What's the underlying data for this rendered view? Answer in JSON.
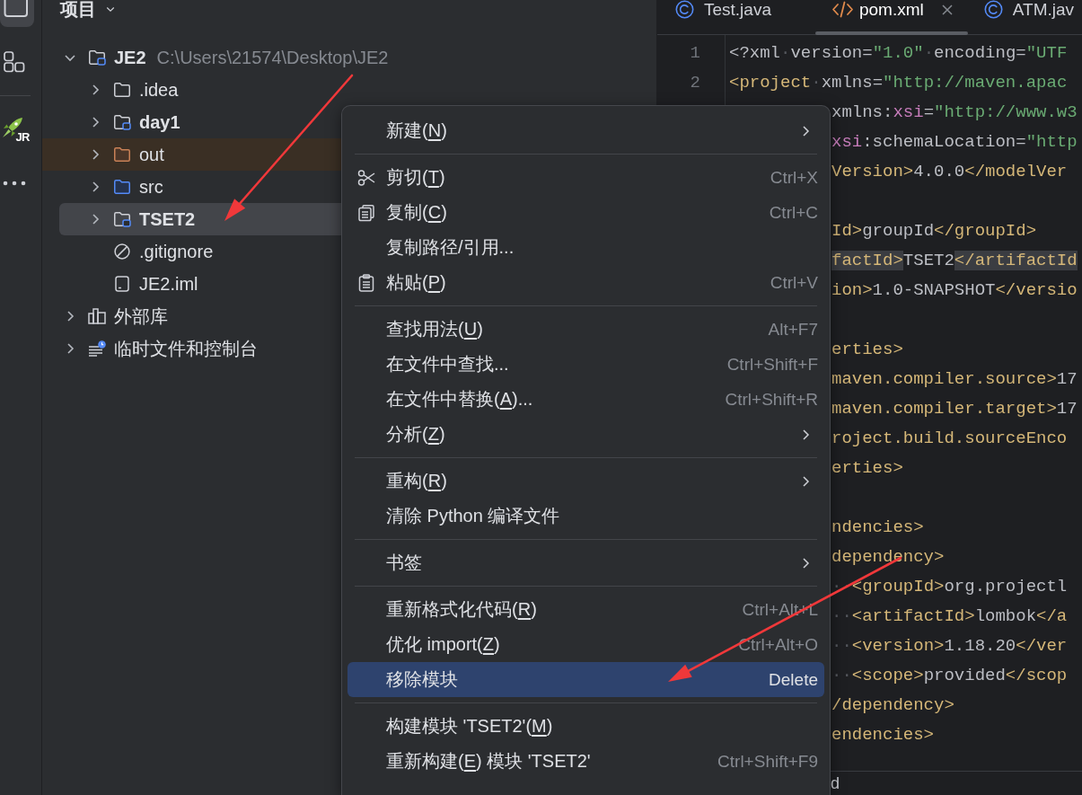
{
  "activity_bar": {
    "items": [
      {
        "kind": "project",
        "selected": true
      },
      {
        "kind": "structure",
        "selected": false
      },
      {
        "kind": "separator"
      },
      {
        "kind": "plugin",
        "label": "JR",
        "selected": false
      },
      {
        "kind": "more",
        "selected": false
      }
    ]
  },
  "project_panel": {
    "title": "项目",
    "tree": [
      {
        "kind": "module",
        "label": "JE2",
        "path": "C:\\Users\\21574\\Desktop\\JE2",
        "expanded": true,
        "selected": false,
        "children": [
          {
            "kind": "folder",
            "label": ".idea",
            "expanded": false,
            "selected": false
          },
          {
            "kind": "module",
            "label": "day1",
            "expanded": false,
            "selected": false
          },
          {
            "kind": "excluded_folder",
            "label": "out",
            "expanded": false,
            "selected": false
          },
          {
            "kind": "source_folder",
            "label": "src",
            "expanded": false,
            "selected": false
          },
          {
            "kind": "module",
            "label": "TSET2",
            "expanded": false,
            "selected": true
          },
          {
            "kind": "ignore_file",
            "label": ".gitignore",
            "selected": false
          },
          {
            "kind": "module_file",
            "label": "JE2.iml",
            "selected": false
          }
        ]
      },
      {
        "kind": "libraries",
        "label": "外部库",
        "expanded": false,
        "selected": false
      },
      {
        "kind": "scratches",
        "label": "临时文件和控制台",
        "expanded": false,
        "selected": false
      }
    ]
  },
  "editor": {
    "tabs": [
      {
        "kind": "class",
        "label": "Test.java",
        "selected": false
      },
      {
        "kind": "xml",
        "label": "pom.xml",
        "selected": true
      },
      {
        "kind": "class",
        "label": "ATM.jav",
        "selected": false
      }
    ],
    "lines": [
      {
        "number": "1",
        "tokens": [
          {
            "kind": "plain",
            "text": "<?xml"
          },
          {
            "kind": "space",
            "text": "·"
          },
          {
            "kind": "plain",
            "text": "version="
          },
          {
            "kind": "string",
            "text": "\"1.0\""
          },
          {
            "kind": "space",
            "text": "·"
          },
          {
            "kind": "plain",
            "text": "encoding="
          },
          {
            "kind": "string",
            "text": "\"UTF"
          }
        ]
      },
      {
        "number": "2",
        "tokens": [
          {
            "kind": "tag",
            "text": "<project"
          },
          {
            "kind": "space",
            "text": "·"
          },
          {
            "kind": "plain",
            "text": "xmlns="
          },
          {
            "kind": "string",
            "text": "\"http://maven.apac"
          }
        ]
      }
    ],
    "partial_lines": [
      {
        "kind": "code",
        "tokens": [
          {
            "kind": "plain",
            "text": "xmlns:"
          },
          {
            "kind": "ns",
            "text": "xsi"
          },
          {
            "kind": "plain",
            "text": "="
          },
          {
            "kind": "string",
            "text": "\"http://www.w3"
          }
        ]
      },
      {
        "kind": "code",
        "tokens": [
          {
            "kind": "ns",
            "text": "xsi"
          },
          {
            "kind": "plain",
            "text": ":schemaLocation="
          },
          {
            "kind": "string",
            "text": "\"http"
          }
        ]
      },
      {
        "kind": "code",
        "tokens": [
          {
            "kind": "tag",
            "text": "Version>"
          },
          {
            "kind": "plain",
            "text": "4.0.0"
          },
          {
            "kind": "tag",
            "text": "</modelVer"
          }
        ]
      },
      {
        "kind": "blank"
      },
      {
        "kind": "code",
        "tokens": [
          {
            "kind": "tag",
            "text": "Id>"
          },
          {
            "kind": "plain",
            "text": "groupId"
          },
          {
            "kind": "tag",
            "text": "</groupId>"
          }
        ]
      },
      {
        "kind": "code",
        "tokens": [
          {
            "kind": "tag_match",
            "text": "factId>"
          },
          {
            "kind": "plain",
            "text": "TSET2"
          },
          {
            "kind": "tag_match",
            "text": "</artifactId"
          }
        ]
      },
      {
        "kind": "code",
        "tokens": [
          {
            "kind": "tag",
            "text": "ion>"
          },
          {
            "kind": "plain",
            "text": "1.0-SNAPSHOT"
          },
          {
            "kind": "tag",
            "text": "</versio"
          }
        ]
      },
      {
        "kind": "blank"
      },
      {
        "kind": "code",
        "tokens": [
          {
            "kind": "tag",
            "text": "erties>"
          }
        ]
      },
      {
        "kind": "code",
        "tokens": [
          {
            "kind": "tag",
            "text": "maven.compiler.source>"
          },
          {
            "kind": "plain",
            "text": "17"
          }
        ]
      },
      {
        "kind": "code",
        "tokens": [
          {
            "kind": "tag",
            "text": "maven.compiler.target>"
          },
          {
            "kind": "plain",
            "text": "17"
          }
        ]
      },
      {
        "kind": "code",
        "tokens": [
          {
            "kind": "tag",
            "text": "roject.build.sourceEnco"
          }
        ]
      },
      {
        "kind": "code",
        "tokens": [
          {
            "kind": "tag",
            "text": "erties>"
          }
        ]
      },
      {
        "kind": "blank"
      },
      {
        "kind": "code",
        "tokens": [
          {
            "kind": "tag",
            "text": "ndencies>"
          }
        ]
      },
      {
        "kind": "code",
        "tokens": [
          {
            "kind": "tag",
            "text": "dependency>"
          }
        ]
      },
      {
        "kind": "code",
        "tokens": [
          {
            "kind": "space",
            "text": "··"
          },
          {
            "kind": "tag",
            "text": "<groupId>"
          },
          {
            "kind": "plain",
            "text": "org.projectl"
          }
        ]
      },
      {
        "kind": "code",
        "tokens": [
          {
            "kind": "space",
            "text": "··"
          },
          {
            "kind": "tag",
            "text": "<artifactId>"
          },
          {
            "kind": "plain",
            "text": "lombok"
          },
          {
            "kind": "tag",
            "text": "</a"
          }
        ]
      },
      {
        "kind": "code",
        "tokens": [
          {
            "kind": "space",
            "text": "··"
          },
          {
            "kind": "tag",
            "text": "<version>"
          },
          {
            "kind": "plain",
            "text": "1.18.20"
          },
          {
            "kind": "tag",
            "text": "</ver"
          }
        ]
      },
      {
        "kind": "code",
        "tokens": [
          {
            "kind": "space",
            "text": "··"
          },
          {
            "kind": "tag",
            "text": "<scope>"
          },
          {
            "kind": "plain",
            "text": "provided"
          },
          {
            "kind": "tag",
            "text": "</scop"
          }
        ]
      },
      {
        "kind": "code",
        "tokens": [
          {
            "kind": "tag",
            "text": "/dependency>"
          }
        ]
      },
      {
        "kind": "code",
        "tokens": [
          {
            "kind": "tag",
            "text": "endencies>"
          }
        ]
      }
    ],
    "breadcrumb": "d"
  },
  "context_menu": {
    "items": [
      {
        "kind": "action",
        "label": "新建(",
        "mnemonic": "N",
        "label_end": ")",
        "submenu": true,
        "selected": false
      },
      {
        "kind": "separator"
      },
      {
        "kind": "action",
        "label": "剪切(",
        "mnemonic": "T",
        "label_end": ")",
        "shortcut": "Ctrl+X",
        "submenu": false,
        "selected": false
      },
      {
        "kind": "action",
        "label": "复制(",
        "mnemonic": "C",
        "label_end": ")",
        "shortcut": "Ctrl+C",
        "submenu": false,
        "selected": false
      },
      {
        "kind": "action",
        "label": "复制路径/引用...",
        "submenu": false,
        "selected": false
      },
      {
        "kind": "action",
        "label": "粘贴(",
        "mnemonic": "P",
        "label_end": ")",
        "shortcut": "Ctrl+V",
        "submenu": false,
        "selected": false
      },
      {
        "kind": "separator"
      },
      {
        "kind": "action",
        "label": "查找用法(",
        "mnemonic": "U",
        "label_end": ")",
        "shortcut": "Alt+F7",
        "submenu": false,
        "selected": false
      },
      {
        "kind": "action",
        "label": "在文件中查找...",
        "shortcut": "Ctrl+Shift+F",
        "submenu": false,
        "selected": false
      },
      {
        "kind": "action",
        "label": "在文件中替换(",
        "mnemonic": "A",
        "label_end": ")...",
        "shortcut": "Ctrl+Shift+R",
        "submenu": false,
        "selected": false
      },
      {
        "kind": "action",
        "label": "分析(",
        "mnemonic": "Z",
        "label_end": ")",
        "submenu": true,
        "selected": false
      },
      {
        "kind": "separator"
      },
      {
        "kind": "action",
        "label": "重构(",
        "mnemonic": "R",
        "label_end": ")",
        "submenu": true,
        "selected": false
      },
      {
        "kind": "action",
        "label": "清除 Python 编译文件",
        "submenu": false,
        "selected": false
      },
      {
        "kind": "separator"
      },
      {
        "kind": "action",
        "label": "书签",
        "submenu": true,
        "selected": false
      },
      {
        "kind": "separator"
      },
      {
        "kind": "action",
        "label": "重新格式化代码(",
        "mnemonic": "R",
        "label_end": ")",
        "shortcut": "Ctrl+Alt+L",
        "submenu": false,
        "selected": false
      },
      {
        "kind": "action",
        "label": "优化 import(",
        "mnemonic": "Z",
        "label_end": ")",
        "shortcut": "Ctrl+Alt+O",
        "submenu": false,
        "selected": false
      },
      {
        "kind": "action",
        "label": "移除模块",
        "shortcut": "Delete",
        "submenu": false,
        "selected": true
      },
      {
        "kind": "separator"
      },
      {
        "kind": "action",
        "label": "构建模块 'TSET2'(",
        "mnemonic": "M",
        "label_end": ")",
        "submenu": false,
        "selected": false
      },
      {
        "kind": "action",
        "label": "重新构建(",
        "mnemonic": "E",
        "label_end": ") 模块 'TSET2'",
        "shortcut": "Ctrl+Shift+F9",
        "submenu": false,
        "selected": false
      }
    ]
  },
  "annotations": [
    {
      "kind": "arrow"
    },
    {
      "kind": "arrow"
    }
  ]
}
